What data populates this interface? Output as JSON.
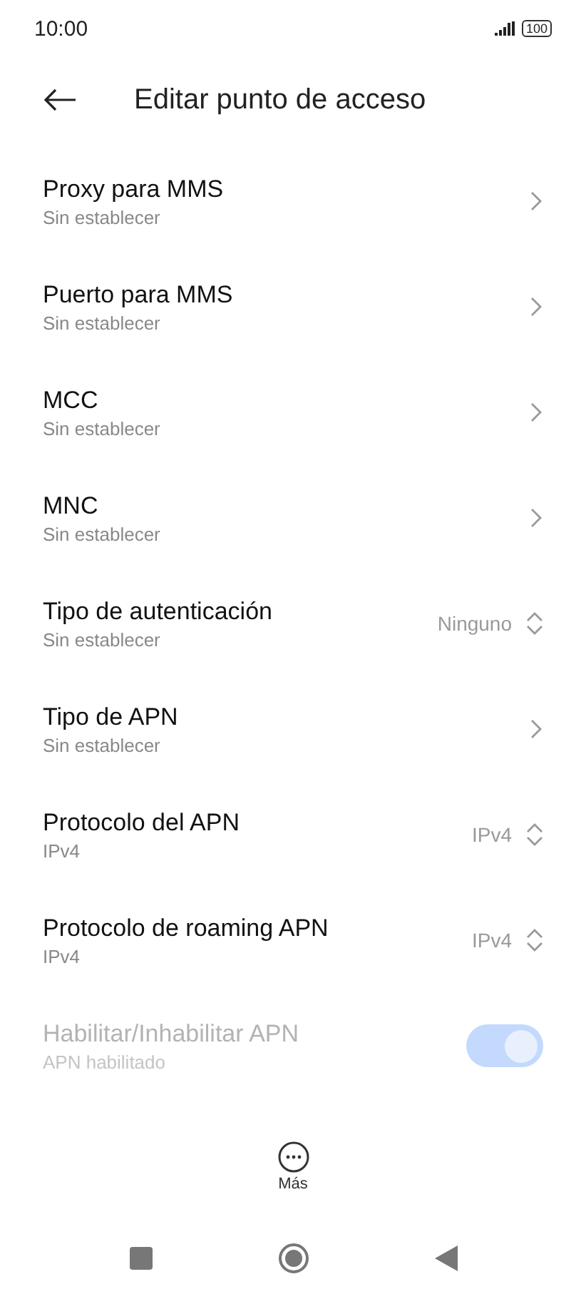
{
  "status_bar": {
    "time": "10:00",
    "battery": "100"
  },
  "header": {
    "title": "Editar punto de acceso"
  },
  "settings": [
    {
      "kind": "link",
      "title": "Proxy para MMS",
      "subtitle": "Sin establecer"
    },
    {
      "kind": "link",
      "title": "Puerto para MMS",
      "subtitle": "Sin establecer"
    },
    {
      "kind": "link",
      "title": "MCC",
      "subtitle": "Sin establecer"
    },
    {
      "kind": "link",
      "title": "MNC",
      "subtitle": "Sin establecer"
    },
    {
      "kind": "select",
      "title": "Tipo de autenticación",
      "subtitle": "Sin establecer",
      "value": "Ninguno"
    },
    {
      "kind": "link",
      "title": "Tipo de APN",
      "subtitle": "Sin establecer"
    },
    {
      "kind": "select",
      "title": "Protocolo del APN",
      "subtitle": "IPv4",
      "value": "IPv4"
    },
    {
      "kind": "select",
      "title": "Protocolo de roaming APN",
      "subtitle": "IPv4",
      "value": "IPv4"
    },
    {
      "kind": "toggle",
      "title": "Habilitar/Inhabilitar APN",
      "subtitle": "APN habilitado",
      "on": true,
      "disabled": true
    }
  ],
  "bottom_action": {
    "label": "Más"
  }
}
